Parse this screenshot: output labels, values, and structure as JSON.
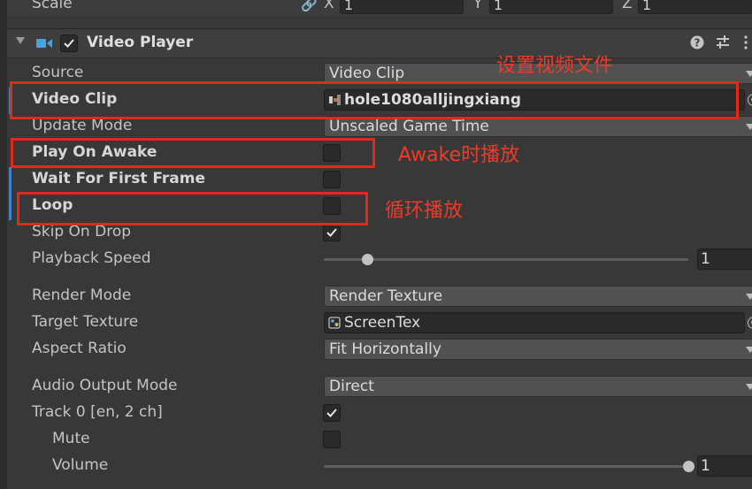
{
  "scale_row": {
    "label": "Scale",
    "x_label": "X",
    "x_value": "1",
    "y_label": "Y",
    "y_value": "1",
    "z_label": "Z",
    "z_value": "1"
  },
  "component": {
    "title": "Video Player",
    "enabled": true
  },
  "rows": {
    "source": {
      "label": "Source",
      "value": "Video Clip"
    },
    "video_clip": {
      "label": "Video Clip",
      "value": "hole1080alljingxiang"
    },
    "update_mode": {
      "label": "Update Mode",
      "value": "Unscaled Game Time"
    },
    "play_on_awake": {
      "label": "Play On Awake",
      "checked": false
    },
    "wait_first_frame": {
      "label": "Wait For First Frame",
      "checked": false
    },
    "loop": {
      "label": "Loop",
      "checked": false
    },
    "skip_on_drop": {
      "label": "Skip On Drop",
      "checked": true
    },
    "playback_speed": {
      "label": "Playback Speed",
      "value": "1",
      "slider_fraction": 0.12
    },
    "render_mode": {
      "label": "Render Mode",
      "value": "Render Texture"
    },
    "target_texture": {
      "label": "Target Texture",
      "value": "ScreenTex"
    },
    "aspect_ratio": {
      "label": "Aspect Ratio",
      "value": "Fit Horizontally"
    },
    "audio_output_mode": {
      "label": "Audio Output Mode",
      "value": "Direct"
    },
    "track0": {
      "label": "Track 0 [en, 2 ch]",
      "checked": true
    },
    "mute": {
      "label": "Mute",
      "checked": false
    },
    "volume": {
      "label": "Volume",
      "value": "1",
      "slider_fraction": 1.0
    }
  },
  "annotations": {
    "video_file": "设置视频文件",
    "awake_play": "Awake时播放",
    "loop_play": "循环播放"
  },
  "colors": {
    "annotation_red": "#e12a1a",
    "accent_blue": "#3a86c8"
  },
  "icons": {
    "video_player": "video-camera-icon",
    "help": "help-icon",
    "presets": "sliders-icon",
    "menu": "kebab-menu-icon",
    "picker": "object-picker-icon"
  }
}
